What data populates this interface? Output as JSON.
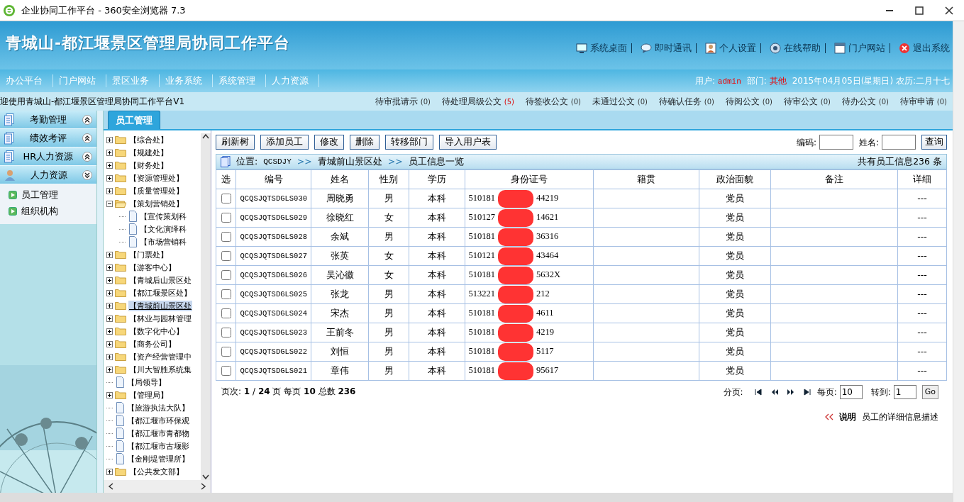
{
  "window": {
    "title": "企业协同工作平台 - 360安全浏览器 7.3"
  },
  "header": {
    "title": "青城山-都江堰景区管理局协同工作平台",
    "links": [
      "系统桌面",
      "即时通讯",
      "个人设置",
      "在线帮助",
      "门户网站",
      "退出系统"
    ]
  },
  "nav": [
    "办公平台",
    "门户网站",
    "景区业务",
    "业务系统",
    "系统管理",
    "人力资源"
  ],
  "user_info": {
    "user_label": "用户:",
    "user": "admin",
    "dept_label": "部门:",
    "dept": "其他",
    "date": "2015年04月05日(星期日) 农历:二月十七"
  },
  "welcome": "迎使用青城山-都江堰景区管理局协同工作平台V1",
  "counters": [
    {
      "label": "待审批请示",
      "count": "(0)",
      "alert": false
    },
    {
      "label": "待处理局级公文",
      "count": "(5)",
      "alert": true
    },
    {
      "label": "待签收公文",
      "count": "(0)",
      "alert": false
    },
    {
      "label": "未通过公文",
      "count": "(0)",
      "alert": false
    },
    {
      "label": "待确认任务",
      "count": "(0)",
      "alert": false
    },
    {
      "label": "待阅公文",
      "count": "(0)",
      "alert": false
    },
    {
      "label": "待审公文",
      "count": "(0)",
      "alert": false
    },
    {
      "label": "待办公文",
      "count": "(0)",
      "alert": false
    },
    {
      "label": "待审申请",
      "count": "(0)",
      "alert": false
    }
  ],
  "sidebar": [
    {
      "label": "考勤管理",
      "expanded": false
    },
    {
      "label": "绩效考评",
      "expanded": false
    },
    {
      "label": "HR人力资源",
      "expanded": false
    },
    {
      "label": "人力资源",
      "expanded": true,
      "items": [
        "员工管理",
        "组织机构"
      ]
    }
  ],
  "tab": {
    "label": "员工管理",
    "selected": true
  },
  "tree": [
    {
      "label": "【综合处】",
      "kind": "folder",
      "expanded": false,
      "selected": false
    },
    {
      "label": "【规建处】",
      "kind": "folder",
      "expanded": false,
      "selected": false
    },
    {
      "label": "【财务处】",
      "kind": "folder",
      "expanded": false,
      "selected": false
    },
    {
      "label": "【资源管理处】",
      "kind": "folder",
      "expanded": false,
      "selected": false
    },
    {
      "label": "【质量管理处】",
      "kind": "folder",
      "expanded": false,
      "selected": false
    },
    {
      "label": "【策划营销处】",
      "kind": "folder",
      "expanded": true,
      "selected": false,
      "children": [
        {
          "label": "【宣传策划科",
          "kind": "doc",
          "selected": false
        },
        {
          "label": "【文化演绎科",
          "kind": "doc",
          "selected": false
        },
        {
          "label": "【市场营销科",
          "kind": "doc",
          "selected": false
        }
      ]
    },
    {
      "label": "【门票处】",
      "kind": "folder",
      "expanded": false,
      "selected": false
    },
    {
      "label": "【游客中心】",
      "kind": "folder",
      "expanded": false,
      "selected": false
    },
    {
      "label": "【青城后山景区处",
      "kind": "folder",
      "expanded": false,
      "selected": false
    },
    {
      "label": "【都江堰景区处】",
      "kind": "folder",
      "expanded": false,
      "selected": false
    },
    {
      "label": "【青城前山景区处",
      "kind": "folder",
      "expanded": false,
      "selected": true
    },
    {
      "label": "【林业与园林管理",
      "kind": "folder",
      "expanded": false,
      "selected": false
    },
    {
      "label": "【数字化中心】",
      "kind": "folder",
      "expanded": false,
      "selected": false
    },
    {
      "label": "【商务公司】",
      "kind": "folder",
      "expanded": false,
      "selected": false
    },
    {
      "label": "【资产经营管理中",
      "kind": "folder",
      "expanded": false,
      "selected": false
    },
    {
      "label": "【川大智胜系统集",
      "kind": "folder",
      "expanded": false,
      "selected": false
    },
    {
      "label": "【局领导】",
      "kind": "doc",
      "selected": false
    },
    {
      "label": "【管理局】",
      "kind": "folder",
      "expanded": false,
      "selected": false
    },
    {
      "label": "【旅游执法大队】",
      "kind": "doc",
      "selected": false
    },
    {
      "label": "【都江堰市环保观",
      "kind": "doc",
      "selected": false
    },
    {
      "label": "【都江堰市青都物",
      "kind": "doc",
      "selected": false
    },
    {
      "label": "【都江堰市古堰影",
      "kind": "doc",
      "selected": false
    },
    {
      "label": "【金刚堤管理所】",
      "kind": "doc",
      "selected": false
    },
    {
      "label": "【公共发文部】",
      "kind": "folder",
      "expanded": false,
      "selected": false
    }
  ],
  "toolbar": {
    "buttons": [
      "刷新树",
      "添加员工",
      "修改",
      "删除",
      "转移部门",
      "导入用户表"
    ],
    "code_label": "编码:",
    "name_label": "姓名:",
    "search": "查询"
  },
  "breadcrumb": {
    "label": "位置:",
    "path": [
      "QCSDJY",
      ">>",
      "青城前山景区处",
      ">>",
      "员工信息一览"
    ],
    "total": "共有员工信息236 条"
  },
  "table": {
    "columns": [
      "选",
      "编号",
      "姓名",
      "性别",
      "学历",
      "身份证号",
      "籍贯",
      "政治面貌",
      "备注",
      "详细"
    ],
    "id_redacted": true,
    "rows": [
      {
        "selected": false,
        "code": "QCQSJQTSDGLS030",
        "name": "周晓勇",
        "gender": "男",
        "edu": "本科",
        "id_start": "510181",
        "id_end": "44219",
        "politics": "党员",
        "detail": "---"
      },
      {
        "selected": false,
        "code": "QCQSJQTSDGLS029",
        "name": "徐晓红",
        "gender": "女",
        "edu": "本科",
        "id_start": "510127",
        "id_end": "14621",
        "politics": "党员",
        "detail": "---"
      },
      {
        "selected": false,
        "code": "QCQSJQTSDGLS028",
        "name": "余斌",
        "gender": "男",
        "edu": "本科",
        "id_start": "510181",
        "id_end": "36316",
        "politics": "党员",
        "detail": "---"
      },
      {
        "selected": false,
        "code": "QCQSJQTSDGLS027",
        "name": "张英",
        "gender": "女",
        "edu": "本科",
        "id_start": "510121",
        "id_end": "43464",
        "politics": "党员",
        "detail": "---"
      },
      {
        "selected": false,
        "code": "QCQSJQTSDGLS026",
        "name": "吴沁徽",
        "gender": "女",
        "edu": "本科",
        "id_start": "510181",
        "id_end": "5632X",
        "politics": "党员",
        "detail": "---"
      },
      {
        "selected": false,
        "code": "QCQSJQTSDGLS025",
        "name": "张龙",
        "gender": "男",
        "edu": "本科",
        "id_start": "513221",
        "id_end": "212",
        "politics": "党员",
        "detail": "---"
      },
      {
        "selected": false,
        "code": "QCQSJQTSDGLS024",
        "name": "宋杰",
        "gender": "男",
        "edu": "本科",
        "id_start": "510181",
        "id_end": "4611",
        "politics": "党员",
        "detail": "---"
      },
      {
        "selected": false,
        "code": "QCQSJQTSDGLS023",
        "name": "王前冬",
        "gender": "男",
        "edu": "本科",
        "id_start": "510181",
        "id_end": "4219",
        "politics": "党员",
        "detail": "---"
      },
      {
        "selected": false,
        "code": "QCQSJQTSDGLS022",
        "name": "刘恒",
        "gender": "男",
        "edu": "本科",
        "id_start": "510181",
        "id_end": "5117",
        "politics": "党员",
        "detail": "---"
      },
      {
        "selected": false,
        "code": "QCQSJQTSDGLS021",
        "name": "章伟",
        "gender": "男",
        "edu": "本科",
        "id_start": "510181",
        "id_end": "95617",
        "politics": "党员",
        "detail": "---"
      }
    ]
  },
  "pager": {
    "summary": "页次: **1** / **24** 页 每页 **10** 总数 **236**",
    "label": "分页:",
    "per_label": "每页:",
    "per": "10",
    "goto_label": "转到:",
    "goto": "1",
    "go": "Go"
  },
  "note": {
    "title": "说明",
    "text": "员工的详细信息描述"
  }
}
